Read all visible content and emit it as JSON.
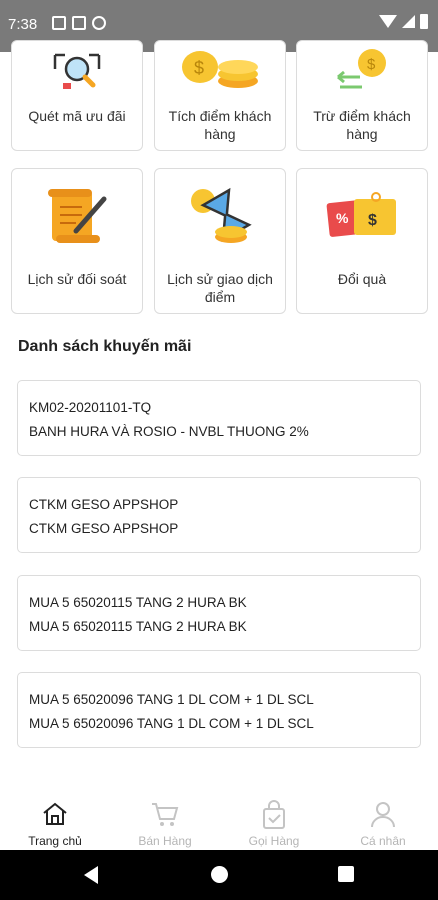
{
  "status_bar": {
    "time": "7:38"
  },
  "features": [
    {
      "label": "Quét mã ưu đãi",
      "icon": "qr-scan-icon"
    },
    {
      "label": "Tích điểm khách hàng",
      "icon": "coins-icon"
    },
    {
      "label": "Trừ điểm khách hàng",
      "icon": "coin-exchange-icon"
    },
    {
      "label": "Lịch sử đối soát",
      "icon": "scroll-pen-icon"
    },
    {
      "label": "Lịch sử giao dịch điểm",
      "icon": "hourglass-coins-icon"
    },
    {
      "label": "Đổi quà",
      "icon": "voucher-icon"
    }
  ],
  "promotions": {
    "title": "Danh sách khuyến mãi",
    "items": [
      {
        "code": "KM02-20201101-TQ",
        "name": "BANH HURA VÀ ROSIO  - NVBL THUONG 2%"
      },
      {
        "code": "CTKM GESO APPSHOP",
        "name": "CTKM GESO APPSHOP"
      },
      {
        "code": "MUA 5 65020115 TANG 2 HURA BK",
        "name": "MUA 5 65020115 TANG 2 HURA BK"
      },
      {
        "code": "MUA 5 65020096 TANG 1 DL COM + 1 DL SCL",
        "name": "MUA 5 65020096 TANG 1 DL COM + 1 DL SCL"
      }
    ]
  },
  "bottom_nav": [
    {
      "label": "Trang chủ",
      "icon": "home-icon",
      "active": true
    },
    {
      "label": "Bán Hàng",
      "icon": "cart-icon",
      "active": false
    },
    {
      "label": "Gọi Hàng",
      "icon": "shopping-bag-icon",
      "active": false
    },
    {
      "label": "Cá nhân",
      "icon": "person-icon",
      "active": false
    }
  ],
  "colors": {
    "accent_orange": "#f5a623",
    "gold": "#f7c531",
    "status_bar": "#7a7a7a"
  }
}
